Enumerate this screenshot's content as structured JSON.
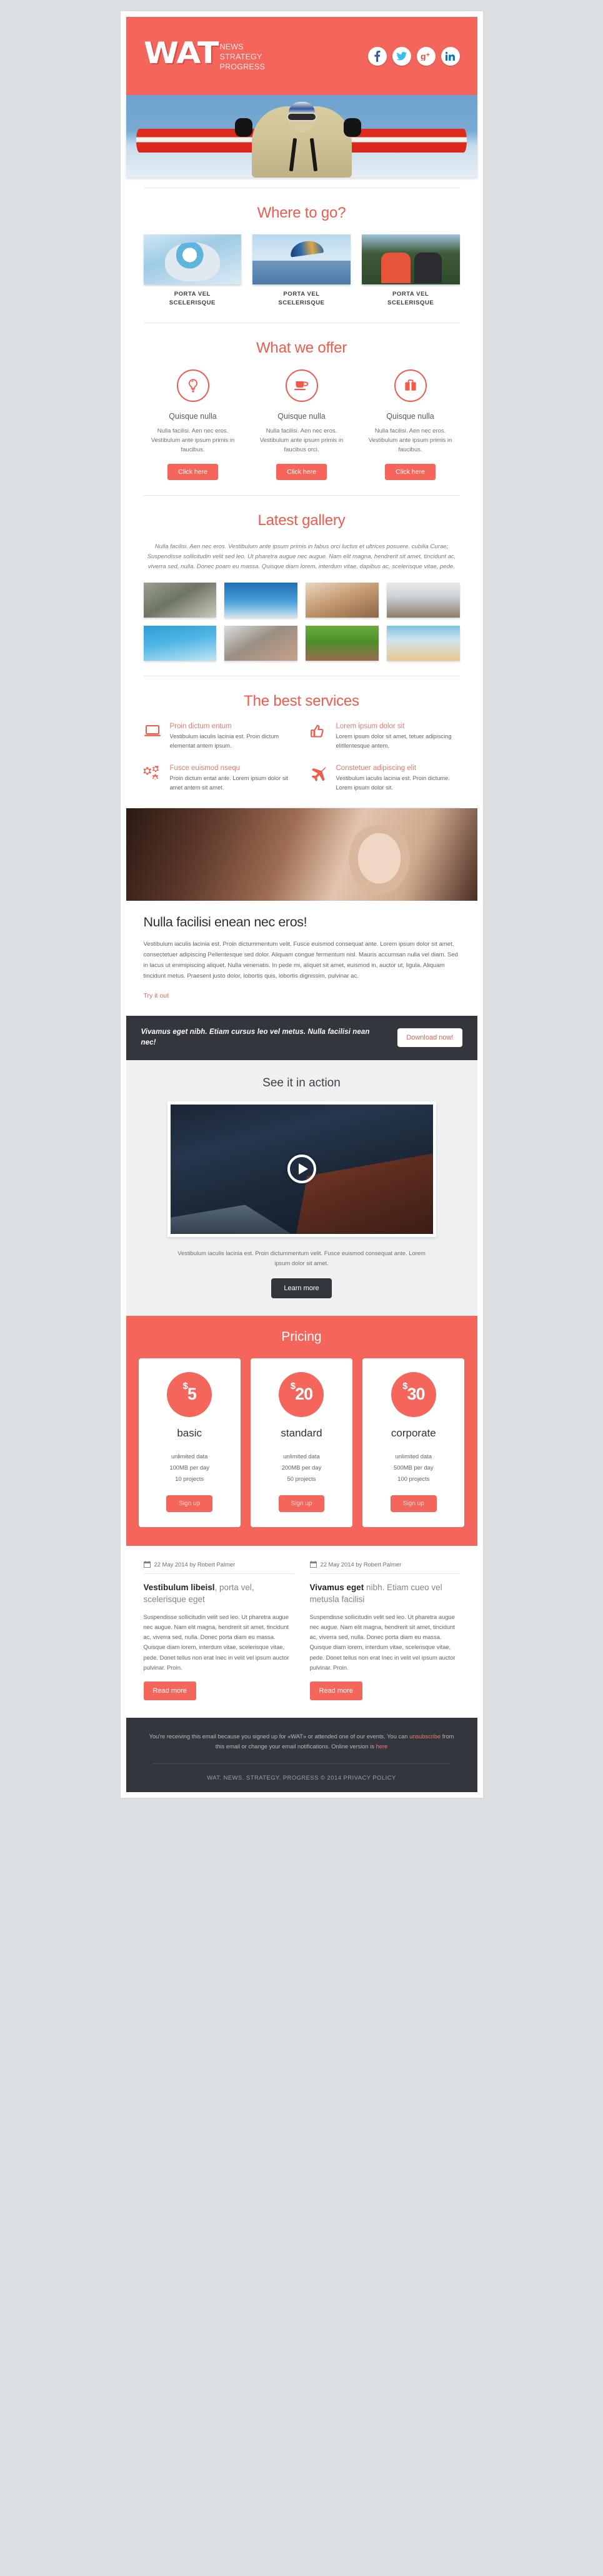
{
  "header": {
    "logo": "WAT",
    "tagline_lines": [
      "NEWS",
      "STRATEGY",
      "PROGRESS"
    ],
    "socials": [
      {
        "name": "facebook",
        "label": "f"
      },
      {
        "name": "twitter",
        "label": "t"
      },
      {
        "name": "google-plus",
        "label": "g+"
      },
      {
        "name": "linkedin",
        "label": "in"
      }
    ]
  },
  "where_to_go": {
    "title": "Where to go?",
    "items": [
      {
        "caption_line1": "PORTA VEL",
        "caption_line2": "SCELERISQUE"
      },
      {
        "caption_line1": "PORTA VEL",
        "caption_line2": "SCELERISQUE"
      },
      {
        "caption_line1": "PORTA VEL",
        "caption_line2": "SCELERISQUE"
      }
    ]
  },
  "what_we_offer": {
    "title": "What we offer",
    "items": [
      {
        "icon": "lightbulb-icon",
        "heading": "Quisque nulla",
        "body": "Nulla facilisi. Aen nec eros. Vestibulum ante ipsum primis in faucibus.",
        "button": "Click here"
      },
      {
        "icon": "coffee-cup-icon",
        "heading": "Quisque nulla",
        "body": "Nulla facilisi. Aen nec eros. Vestibulum ante ipsum primis in faucibus orci.",
        "button": "Click here"
      },
      {
        "icon": "briefcase-icon",
        "heading": "Quisque nulla",
        "body": "Nulla facilisi. Aen nec eros. Vestibulum ante ipsum primis in faucibus.",
        "button": "Click here"
      }
    ]
  },
  "latest_gallery": {
    "title": "Latest gallery",
    "lead": "Nulla facilisi. Aen nec eros. Vestibulum ante ipsum primis in fabus orci luctus et ultrices posuere. cubilia Curae; Suspendisse sollicitudin velit sed leo. Ut pharetra augue nec augue. Nam elit magna, hendrerit sit amet, tincidunt ac, viverra sed, nulla. Donec poam eu massa. Quisque diam lorem, interdum vitae, dapibus ac, scelerisque vitae, pede.",
    "thumbs": [
      "cyclist-photo",
      "paraglider-photo",
      "woman-hair-photo",
      "man-looking-up-photo",
      "swimmer-photo",
      "boxing-woman-photo",
      "cricket-ball-photo",
      "beach-woman-photo"
    ]
  },
  "best_services": {
    "title": "The best services",
    "items": [
      {
        "icon": "laptop-icon",
        "heading": "Proin dictum entum",
        "body": "Vestibulum iaculis lacinia est. Proin dictum elementat antem ipsum."
      },
      {
        "icon": "thumbs-up-icon",
        "heading": "Lorem ipsum dolor sit",
        "body": "Lorem ipsum dolor sit amet, tetuer adipiscing elitllentesque antem."
      },
      {
        "icon": "gears-icon",
        "heading": "Fusce euismod nsequ",
        "body": "Proin dictum entat ante. Lorem ipsum dolor sit amet antem sit amet."
      },
      {
        "icon": "airplane-icon",
        "heading": "Constetuer adipiscing elit",
        "body": "Vestibulum iaculis lacinia est. Proin dictume. Lorem ipsum dolor sit."
      }
    ]
  },
  "article": {
    "image": "woman-portrait-photo",
    "heading": "Nulla facilisi enean nec eros!",
    "body": "Vestibulum iaculis lacinia est. Proin dictummentum velit. Fusce euismod consequat ante. Lorem ipsum dolor sit amet, consectetuer adipiscing Pellentesque sed dolor. Aliquam congue fermentum nisl. Mauris accumsan nulla vel diam. Sed in lacus ut enimipiscing aliquet. Nulla venenatis. In pede mi, aliquet sit amet, euismod in, auctor ut, ligula. Aliquam tincidunt metus. Praesent justo dolor, lobortis quis, lobortis dignissim, pulvinar ac.",
    "link": "Try it out"
  },
  "cta": {
    "text": "Vivamus eget nibh. Etiam cursus leo vel metus. Nulla facilisi nean nec!",
    "button": "Download now!"
  },
  "video": {
    "title": "See it in action",
    "thumbnail": "alpine-resort-photo",
    "play_icon": "play-icon",
    "caption": "Vestibulum iaculis lacinia est. Proin dictummentum velit. Fusce euismod consequat ante. Lorem ipsum dolor sit amet.",
    "button": "Learn more"
  },
  "pricing": {
    "title": "Pricing",
    "plans": [
      {
        "currency": "$",
        "price": "5",
        "name": "basic",
        "features": [
          "unlimited data",
          "100MB per day",
          "10 projects"
        ],
        "button": "Sign up"
      },
      {
        "currency": "$",
        "price": "20",
        "name": "standard",
        "features": [
          "unlimited data",
          "200MB per day",
          "50 projects"
        ],
        "button": "Sign up"
      },
      {
        "currency": "$",
        "price": "30",
        "name": "corporate",
        "features": [
          "unlimited data",
          "500MB per day",
          "100 projects"
        ],
        "button": "Sign up"
      }
    ]
  },
  "blog": {
    "posts": [
      {
        "meta": "22 May 2014 by Robert Palmer",
        "title_bold": "Vestibulum libeisl",
        "title_rest": ", porta vel, scelerisque eget",
        "body": "Suspendisse sollicitudin velit sed leo. Ut pharetra augue nec augue. Nam elit magna, hendrerit sit amet, tincidunt ac, viverra sed, nulla. Donec porta diam eu massa. Quisque diam lorem, interdum vitae, scelerisque vitae, pede. Donet tellus non erat Inec in velit vel ipsum auctor pulvinar. Proin.",
        "button": "Read more"
      },
      {
        "meta": "22 May 2014 by Robert Palmer",
        "title_bold": "Vivamus eget",
        "title_rest": " nibh. Etiam cueo vel metusla facilisi",
        "body": "Suspendisse sollicitudin velit sed leo. Ut pharetra augue nec augue. Nam elit magna, hendrerit sit amet, tincidunt ac, viverra sed, nulla. Donec porta diam eu massa. Quisque diam lorem, interdum vitae, scelerisque vitae, pede. Donet tellus non erat Inec in velit vel ipsum auctor pulvinar. Proin.",
        "button": "Read more"
      }
    ]
  },
  "footer": {
    "disclaimer_part1": "You're receiving this email because you signed up for «WAT» or attended one of our events. You can ",
    "unsubscribe_link": "unsubscribe",
    "disclaimer_part2": " from this email or change your email notifications. Online version is ",
    "here_link": "here",
    "copyright": "WAT. NEWS. STRATEGY. PROGRESS © 2014 PRIVACY POLICY"
  },
  "colors": {
    "accent": "#f4655c",
    "accent_dark": "#ef5b4d",
    "dark": "#33373d",
    "page_bg": "#dcdfe2",
    "grey_section": "#eff0f1"
  }
}
